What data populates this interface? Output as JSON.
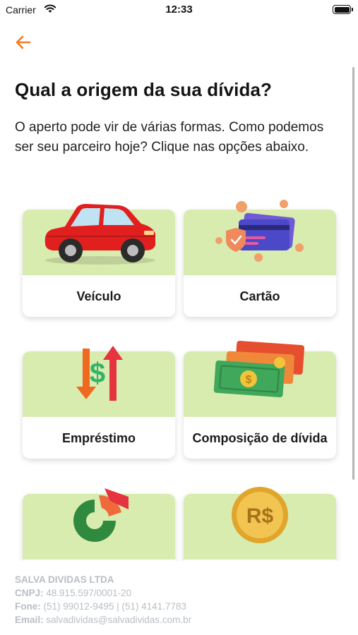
{
  "status_bar": {
    "carrier": "Carrier",
    "time": "12:33"
  },
  "header": {
    "title": "Qual a origem da sua dívida?",
    "subtitle": "O aperto pode vir de várias formas. Como podemos ser seu parceiro hoje? Clique nas opções abaixo."
  },
  "options": [
    {
      "label": "Veículo",
      "icon": "car-icon"
    },
    {
      "label": "Cartão",
      "icon": "credit-card-icon"
    },
    {
      "label": "Empréstimo",
      "icon": "loan-arrows-icon"
    },
    {
      "label": "Composição de dívida",
      "icon": "banknotes-icon"
    },
    {
      "label": "",
      "icon": "pie-chart-icon"
    },
    {
      "label": "",
      "icon": "coin-icon"
    }
  ],
  "footer": {
    "company": "SALVA DIVIDAS LTDA",
    "cnpj_label": "CNPJ:",
    "cnpj": "48.915.597/0001-20",
    "phone_label": "Fone:",
    "phone": "(51) 99012-9495 | (51) 4141.7783",
    "email_label": "Email:",
    "email": "salvadividas@salvadividas.com.br"
  },
  "colors": {
    "accent": "#f47a20",
    "card_image_bg": "#d9ecb0",
    "footer_text": "#b9bec4"
  }
}
